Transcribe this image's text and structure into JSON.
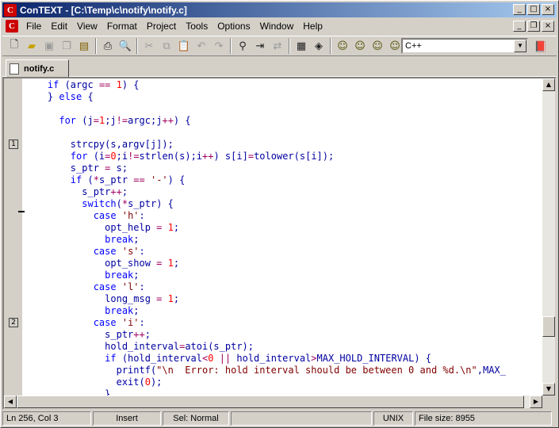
{
  "window": {
    "title": "ConTEXT - [C:\\Temp\\c\\notify\\notify.c]",
    "app_icon": "C"
  },
  "menu": [
    "File",
    "Edit",
    "View",
    "Format",
    "Project",
    "Tools",
    "Options",
    "Window",
    "Help"
  ],
  "toolbar": {
    "icons": [
      "new-file-icon",
      "open-folder-icon",
      "save-icon",
      "save-all-icon",
      "open-project-icon",
      "print-icon",
      "print-preview-icon",
      "cut-icon",
      "copy-icon",
      "paste-icon",
      "undo-icon",
      "redo-icon",
      "find-icon",
      "find-next-icon",
      "replace-icon",
      "toggle-bookmark-icon",
      "highlight-icon",
      "user-exec-1-icon",
      "user-exec-2-icon",
      "user-exec-3-icon",
      "user-exec-4-icon",
      "help-book-icon"
    ],
    "language": "C++"
  },
  "tab": {
    "label": "notify.c"
  },
  "editor": {
    "bookmarks": [
      {
        "label": "1",
        "line_index": 5
      },
      {
        "label": "2",
        "line_index": 20
      }
    ],
    "lines": [
      [
        [
          "    ",
          "t"
        ],
        [
          "if",
          "kw"
        ],
        [
          " (argc ",
          "t"
        ],
        [
          "==",
          "op"
        ],
        [
          " ",
          "t"
        ],
        [
          "1",
          "num"
        ],
        [
          ") {",
          "t"
        ]
      ],
      [
        [
          "    } ",
          "t"
        ],
        [
          "else",
          "kw"
        ],
        [
          " {",
          "t"
        ]
      ],
      [
        [
          "",
          "t"
        ]
      ],
      [
        [
          "      ",
          "t"
        ],
        [
          "for",
          "kw"
        ],
        [
          " (j",
          "t"
        ],
        [
          "=",
          "op"
        ],
        [
          "1",
          "num"
        ],
        [
          ";j",
          "t"
        ],
        [
          "!=",
          "op"
        ],
        [
          "argc;j",
          "t"
        ],
        [
          "++",
          "op"
        ],
        [
          ") {",
          "t"
        ]
      ],
      [
        [
          "",
          "t"
        ]
      ],
      [
        [
          "        strcpy(s,argv[j]);",
          "t"
        ]
      ],
      [
        [
          "        ",
          "t"
        ],
        [
          "for",
          "kw"
        ],
        [
          " (i",
          "t"
        ],
        [
          "=",
          "op"
        ],
        [
          "0",
          "num"
        ],
        [
          ";i",
          "t"
        ],
        [
          "!=",
          "op"
        ],
        [
          "strlen(s);i",
          "t"
        ],
        [
          "++",
          "op"
        ],
        [
          ") s[i]",
          "t"
        ],
        [
          "=",
          "op"
        ],
        [
          "tolower(s[i]);",
          "t"
        ]
      ],
      [
        [
          "        s_ptr ",
          "t"
        ],
        [
          "=",
          "op"
        ],
        [
          " s;",
          "t"
        ]
      ],
      [
        [
          "        ",
          "t"
        ],
        [
          "if",
          "kw"
        ],
        [
          " (",
          "t"
        ],
        [
          "*",
          "op"
        ],
        [
          "s_ptr ",
          "t"
        ],
        [
          "==",
          "op"
        ],
        [
          " ",
          "t"
        ],
        [
          "'-'",
          "str"
        ],
        [
          ") {",
          "t"
        ]
      ],
      [
        [
          "          s_ptr",
          "t"
        ],
        [
          "++",
          "op"
        ],
        [
          ";",
          "t"
        ]
      ],
      [
        [
          "          ",
          "t"
        ],
        [
          "switch",
          "kw"
        ],
        [
          "(",
          "t"
        ],
        [
          "*",
          "op"
        ],
        [
          "s_ptr) {",
          "t"
        ]
      ],
      [
        [
          "            ",
          "t"
        ],
        [
          "case",
          "kw"
        ],
        [
          " ",
          "t"
        ],
        [
          "'h'",
          "str"
        ],
        [
          ":",
          "t"
        ]
      ],
      [
        [
          "              opt_help ",
          "t"
        ],
        [
          "=",
          "op"
        ],
        [
          " ",
          "t"
        ],
        [
          "1",
          "num"
        ],
        [
          ";",
          "t"
        ]
      ],
      [
        [
          "              ",
          "t"
        ],
        [
          "break",
          "kw"
        ],
        [
          ";",
          "t"
        ]
      ],
      [
        [
          "            ",
          "t"
        ],
        [
          "case",
          "kw"
        ],
        [
          " ",
          "t"
        ],
        [
          "'s'",
          "str"
        ],
        [
          ":",
          "t"
        ]
      ],
      [
        [
          "              opt_show ",
          "t"
        ],
        [
          "=",
          "op"
        ],
        [
          " ",
          "t"
        ],
        [
          "1",
          "num"
        ],
        [
          ";",
          "t"
        ]
      ],
      [
        [
          "              ",
          "t"
        ],
        [
          "break",
          "kw"
        ],
        [
          ";",
          "t"
        ]
      ],
      [
        [
          "            ",
          "t"
        ],
        [
          "case",
          "kw"
        ],
        [
          " ",
          "t"
        ],
        [
          "'l'",
          "str"
        ],
        [
          ":",
          "t"
        ]
      ],
      [
        [
          "              long_msg ",
          "t"
        ],
        [
          "=",
          "op"
        ],
        [
          " ",
          "t"
        ],
        [
          "1",
          "num"
        ],
        [
          ";",
          "t"
        ]
      ],
      [
        [
          "              ",
          "t"
        ],
        [
          "break",
          "kw"
        ],
        [
          ";",
          "t"
        ]
      ],
      [
        [
          "            ",
          "t"
        ],
        [
          "case",
          "kw"
        ],
        [
          " ",
          "t"
        ],
        [
          "'i'",
          "str"
        ],
        [
          ":",
          "t"
        ]
      ],
      [
        [
          "              s_ptr",
          "t"
        ],
        [
          "++",
          "op"
        ],
        [
          ";",
          "t"
        ]
      ],
      [
        [
          "              hold_interval",
          "t"
        ],
        [
          "=",
          "op"
        ],
        [
          "atoi(s_ptr);",
          "t"
        ]
      ],
      [
        [
          "              ",
          "t"
        ],
        [
          "if",
          "kw"
        ],
        [
          " (hold_interval",
          "t"
        ],
        [
          "<",
          "op"
        ],
        [
          "0",
          "num"
        ],
        [
          " ",
          "t"
        ],
        [
          "||",
          "op"
        ],
        [
          " hold_interval",
          "t"
        ],
        [
          ">",
          "op"
        ],
        [
          "MAX_HOLD_INTERVAL) {",
          "t"
        ]
      ],
      [
        [
          "                printf(",
          "t"
        ],
        [
          "\"\\n  Error: hold interval should be between 0 and %d.\\n\"",
          "str"
        ],
        [
          ",MAX_",
          "t"
        ]
      ],
      [
        [
          "                exit(",
          "t"
        ],
        [
          "0",
          "num"
        ],
        [
          ");",
          "t"
        ]
      ],
      [
        [
          "              }",
          "t"
        ]
      ]
    ]
  },
  "status": {
    "position": "Ln 256, Col 3",
    "mode": "Insert",
    "selection": "Sel: Normal",
    "empty": "",
    "format": "UNIX",
    "filesize": "File size: 8955"
  }
}
